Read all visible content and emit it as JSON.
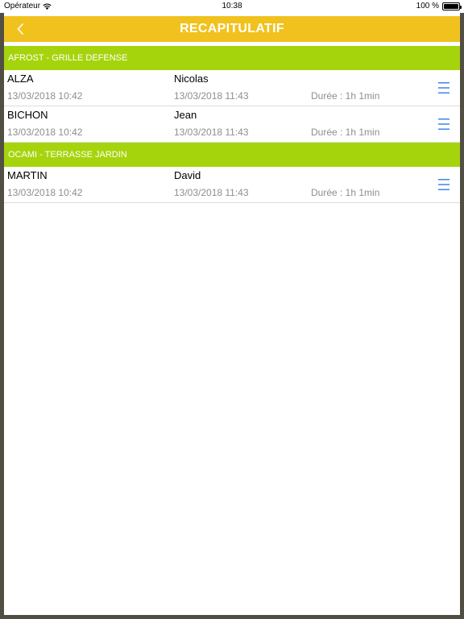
{
  "status_bar": {
    "carrier": "Opérateur",
    "time": "10:38",
    "battery": "100 %"
  },
  "nav": {
    "title": "RECAPITULATIF"
  },
  "colors": {
    "nav": "#f1c21e",
    "section": "#a6d40c",
    "menu_icon": "#3e86e6"
  },
  "sections": [
    {
      "header": "AFROST  -  GRILLE DEFENSE",
      "rows": [
        {
          "lastname": "ALZA",
          "firstname": "Nicolas",
          "start": "13/03/2018 10:42",
          "end": "13/03/2018 11:43",
          "duration": "Durée : 1h 1min"
        },
        {
          "lastname": "BICHON",
          "firstname": "Jean",
          "start": "13/03/2018 10:42",
          "end": "13/03/2018 11:43",
          "duration": "Durée : 1h 1min"
        }
      ]
    },
    {
      "header": "OCAMI  -  TERRASSE JARDIN",
      "rows": [
        {
          "lastname": "MARTIN",
          "firstname": "David",
          "start": "13/03/2018 10:42",
          "end": "13/03/2018 11:43",
          "duration": "Durée : 1h 1min"
        }
      ]
    }
  ]
}
